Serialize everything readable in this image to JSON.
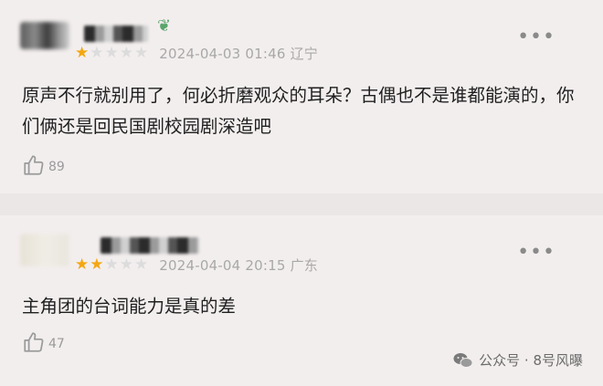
{
  "reviews": [
    {
      "rating": 1,
      "max_rating": 5,
      "date": "2024-04-03 01:46",
      "location": "辽宁",
      "text": "原声不行就别用了，何必折磨观众的耳朵？古偶也不是谁都能演的，你们俩还是回民国剧校园剧深造吧",
      "likes": "89"
    },
    {
      "rating": 2,
      "max_rating": 5,
      "date": "2024-04-04 20:15",
      "location": "广东",
      "text": "主角团的台词能力是真的差",
      "likes": "47"
    }
  ],
  "watermark": {
    "text": "公众号 · 8号风曝"
  },
  "colors": {
    "star_on": "#f3a712",
    "star_off": "#dcdcdc",
    "background": "#f3eeee"
  },
  "icons": [
    "more-icon",
    "thumbs-up-icon",
    "star-icon",
    "wechat-logo-icon"
  ]
}
